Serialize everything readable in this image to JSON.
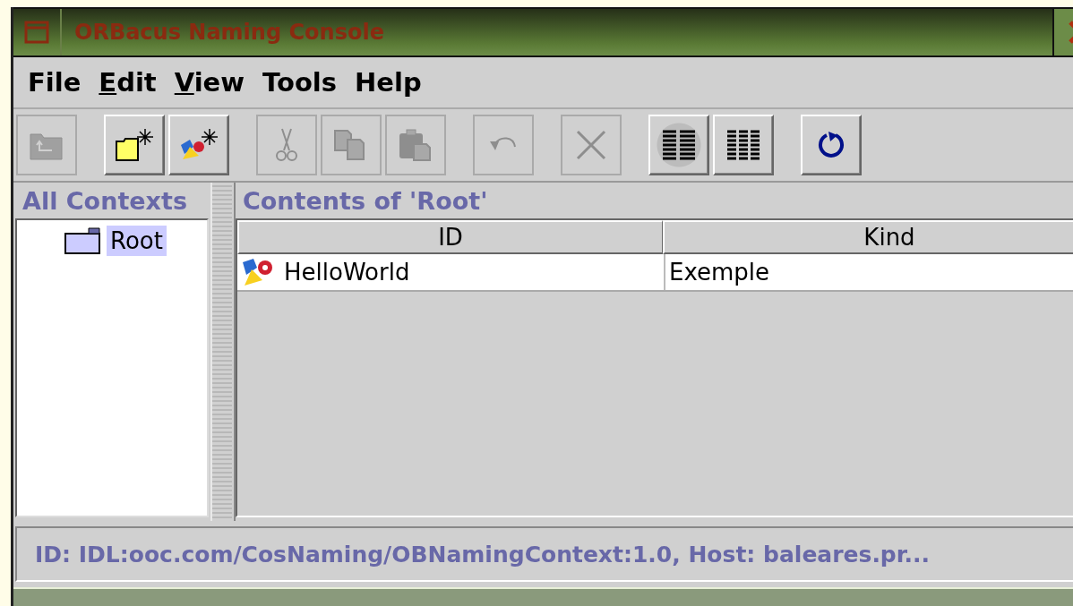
{
  "window": {
    "title": "ORBacus Naming Console"
  },
  "menu": [
    {
      "label": "File",
      "mnemonic": false
    },
    {
      "label": "Edit",
      "mnemonic": true
    },
    {
      "label": "View",
      "mnemonic": true
    },
    {
      "label": "Tools",
      "mnemonic": false
    },
    {
      "label": "Help",
      "mnemonic": false
    }
  ],
  "toolbar": [
    {
      "kind": "up",
      "enabled": false
    },
    {
      "kind": "gap"
    },
    {
      "kind": "new-context",
      "enabled": true
    },
    {
      "kind": "new-object",
      "enabled": true
    },
    {
      "kind": "gap"
    },
    {
      "kind": "cut",
      "enabled": false
    },
    {
      "kind": "copy",
      "enabled": false
    },
    {
      "kind": "paste",
      "enabled": false
    },
    {
      "kind": "gap"
    },
    {
      "kind": "undo",
      "enabled": false
    },
    {
      "kind": "gap"
    },
    {
      "kind": "delete",
      "enabled": false
    },
    {
      "kind": "gap"
    },
    {
      "kind": "details-view",
      "enabled": true,
      "selected": true
    },
    {
      "kind": "list-view",
      "enabled": true,
      "selected": false
    },
    {
      "kind": "gap"
    },
    {
      "kind": "refresh",
      "enabled": true
    }
  ],
  "contexts": {
    "title": "All Contexts",
    "items": [
      {
        "label": "Root",
        "selected": true
      }
    ]
  },
  "contents": {
    "title": "Contents of 'Root'",
    "columns": [
      "ID",
      "Kind"
    ],
    "rows": [
      {
        "cells": [
          "HelloWorld",
          "Exemple"
        ],
        "selected": false
      }
    ]
  },
  "status_bar": "ID: IDL:ooc.com/CosNaming/OBNamingContext:1.0, Host: baleares.pr..."
}
